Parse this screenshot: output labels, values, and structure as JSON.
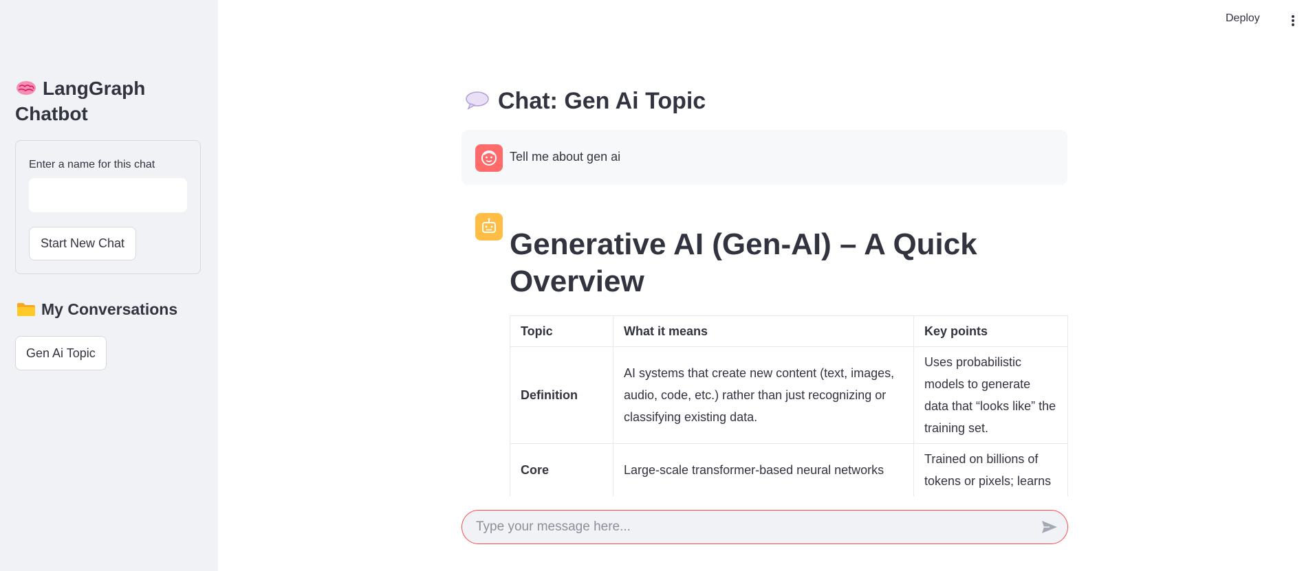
{
  "sidebar": {
    "title": "LangGraph Chatbot",
    "title_icon": "brain-icon",
    "new_chat_label": "Enter a name for this chat",
    "new_chat_value": "",
    "start_button": "Start New Chat",
    "conversations_heading": "My Conversations",
    "conversations_icon": "folder-icon",
    "conversations": [
      {
        "label": "Gen Ai Topic"
      }
    ]
  },
  "header": {
    "deploy_label": "Deploy",
    "menu_icon": "kebab-menu-icon"
  },
  "main": {
    "title": "Chat: Gen Ai Topic",
    "title_icon": "speech-bubble-icon",
    "messages": [
      {
        "role": "user",
        "avatar_icon": "user-face-icon",
        "text": "Tell me about gen ai"
      },
      {
        "role": "assistant",
        "avatar_icon": "robot-icon",
        "heading": "Generative AI (Gen-AI) – A Quick Overview",
        "table": {
          "headers": [
            "Topic",
            "What it means",
            "Key points"
          ],
          "rows": [
            [
              "Definition",
              "AI systems that create new content (text, images, audio, code, etc.) rather than just recognizing or classifying existing data.",
              "Uses probabilistic models to generate data that “looks like” the training set."
            ],
            [
              "Core",
              "Large-scale transformer-based neural networks",
              "Trained on billions of tokens or pixels; learns"
            ]
          ]
        }
      }
    ]
  },
  "chat_input": {
    "placeholder": "Type your message here...",
    "value": "",
    "send_icon": "send-icon"
  },
  "colors": {
    "sidebar_bg": "#f0f2f6",
    "user_avatar": "#ff6b6b",
    "bot_avatar": "#ffbd45",
    "input_border": "#ff4b4b",
    "text": "#31333f"
  }
}
